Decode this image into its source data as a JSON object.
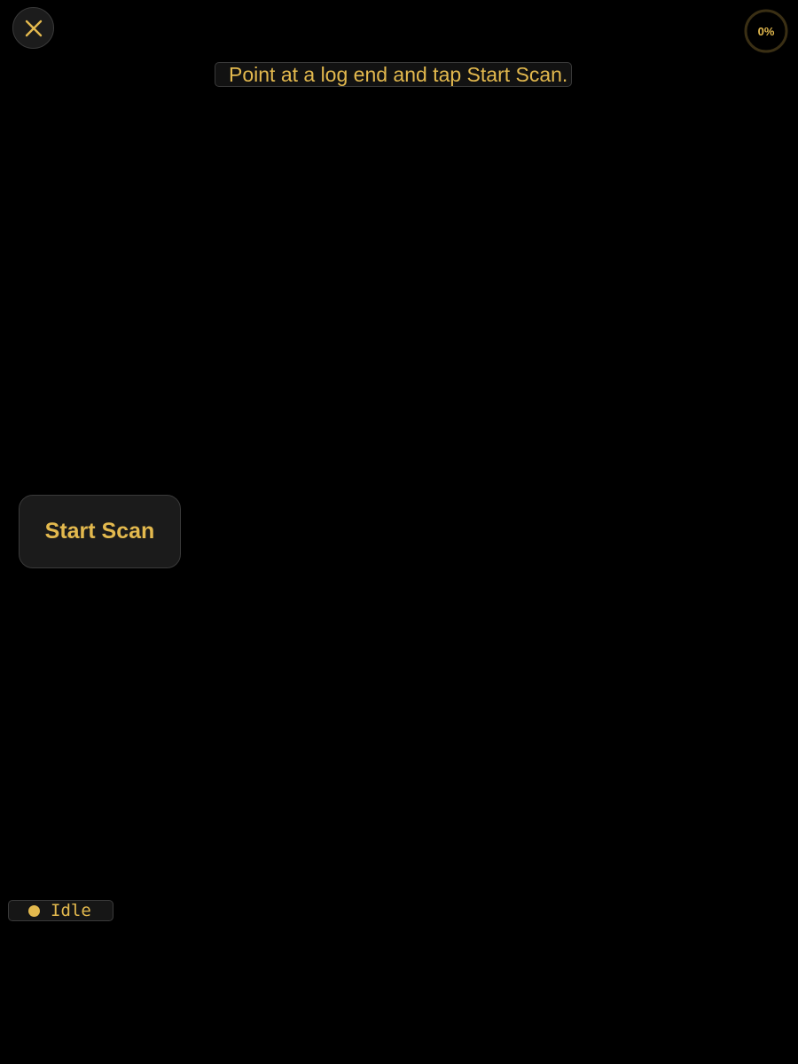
{
  "header": {
    "close_icon": "close-icon",
    "progress_label": "0%",
    "progress_value": 0
  },
  "hint": {
    "text": "Point at a log end and tap Start Scan."
  },
  "controls": {
    "start_label": "Start Scan"
  },
  "status": {
    "indicator_icon": "status-dot-icon",
    "text": "Idle"
  },
  "colors": {
    "accent": "#E3B94E",
    "background": "#000000",
    "surface": "#1B1B1B",
    "border": "#3A3A3A",
    "ring_track": "#3A2F14"
  }
}
